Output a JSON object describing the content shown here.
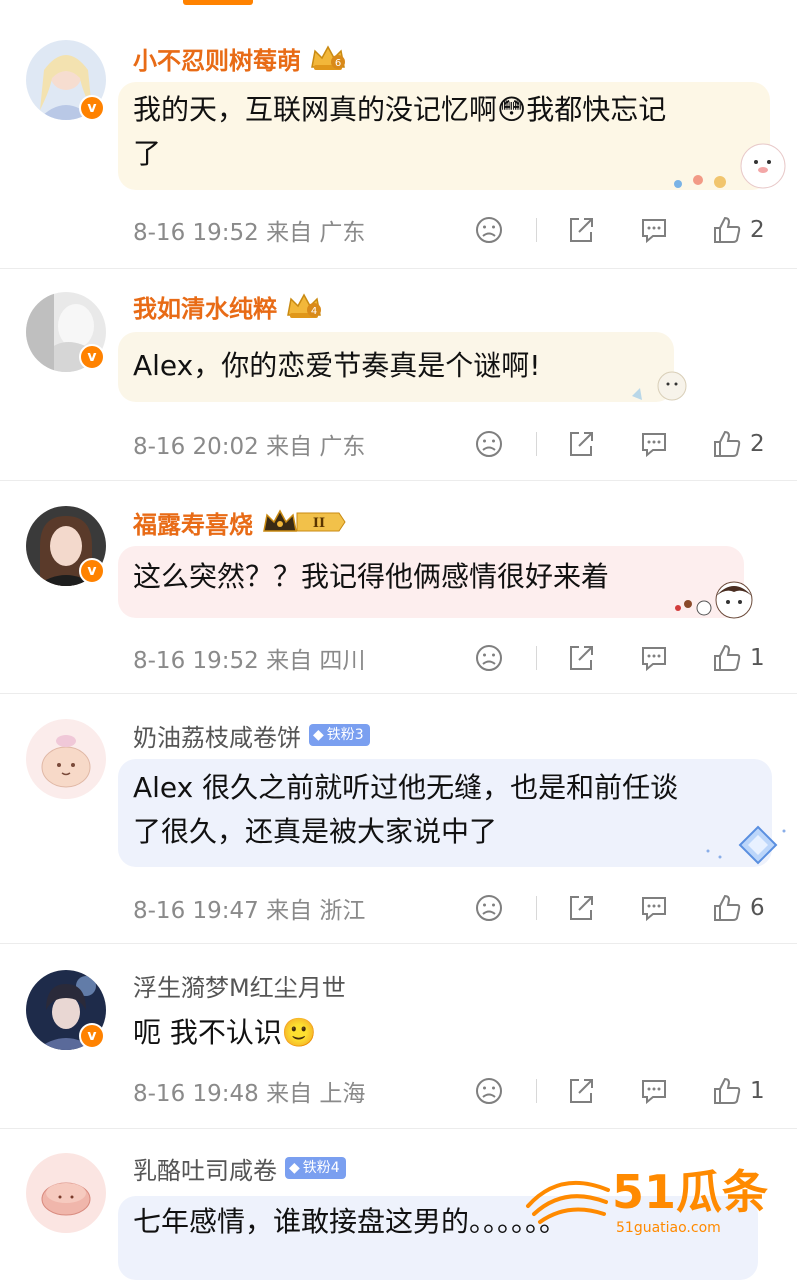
{
  "comments": [
    {
      "username": "小不忍则树莓萌",
      "name_style": "vip",
      "crown_level": "6",
      "text_lines": [
        "我的天，互联网真的没记忆啊😳我都快忘记",
        "了"
      ],
      "meta": "8-16 19:52  来自 广东",
      "likes": "2",
      "bubble_color": "#fdf7e6"
    },
    {
      "username": "我如清水纯粹",
      "name_style": "vip",
      "crown_level": "4",
      "text_lines": [
        "Alex，你的恋爱节奏真是个谜啊!"
      ],
      "meta": "8-16 20:02  来自 广东",
      "likes": "2",
      "bubble_color": "#fbf6e8"
    },
    {
      "username": "福露寿喜烧",
      "name_style": "vip",
      "crown_level": "II",
      "text_lines": [
        "这么突然？？我记得他俩感情很好来着"
      ],
      "meta": "8-16 19:52  来自 四川",
      "likes": "1",
      "bubble_color": "#fdeeee"
    },
    {
      "username": "奶油荔枝咸卷饼",
      "name_style": "plain",
      "fan_badge": "铁粉3",
      "text_lines": [
        "Alex 很久之前就听过他无缝，也是和前任谈",
        "了很久，还真是被大家说中了"
      ],
      "meta": "8-16 19:47  来自 浙江",
      "likes": "6",
      "bubble_color": "#eef2fc"
    },
    {
      "username": "浮生漪梦M红尘月世",
      "name_style": "plain",
      "text_lines": [
        "呃 我不认识🙂"
      ],
      "meta": "8-16 19:48  来自 上海",
      "likes": "1"
    },
    {
      "username": "乳酪吐司咸卷",
      "name_style": "plain",
      "fan_badge": "铁粉4",
      "text_lines": [
        "七年感情，谁敢接盘这男的。。。。。。"
      ],
      "meta": "",
      "likes": "",
      "bubble_color": "#eef2fc"
    }
  ],
  "watermark": {
    "brand": "51瓜条",
    "url": "51guatiao.com",
    "color": "#ff8a00"
  }
}
